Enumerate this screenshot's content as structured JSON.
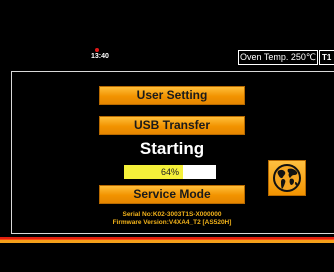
{
  "status_bar": {
    "time": "13:40",
    "oven_temp": "Oven Temp.  250℃",
    "extra_label": "T1"
  },
  "menu": {
    "user_setting": "User Setting",
    "usb_transfer": "USB Transfer",
    "service_mode": "Service Mode"
  },
  "status": {
    "text": "Starting",
    "progress_percent": 64,
    "progress_label": "64%"
  },
  "device_info": {
    "serial": "Serial No:K02-3003T1S-X000000",
    "firmware": "Firmware Version:V4XA4_T2 [AS520H]"
  },
  "icons": {
    "language": "globe-icon"
  },
  "colors": {
    "accent": "#f29300",
    "info_text": "#f2b21a",
    "progress_fill": "#f5f03a",
    "stripe_red": "#e02010",
    "stripe_orange": "#f5a01a"
  }
}
